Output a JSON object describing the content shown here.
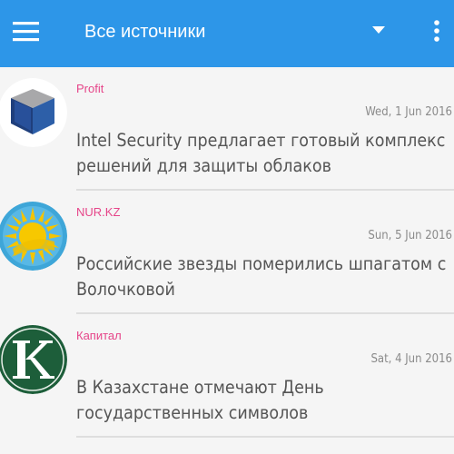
{
  "toolbar": {
    "title": "Все источники",
    "background": "#2d96e8",
    "menu_icon": "hamburger-menu-icon",
    "dropdown_icon": "caret-down-icon",
    "overflow_icon": "more-vert-icon"
  },
  "news": [
    {
      "source": "Profit",
      "date": "Wed, 1 Jun 2016",
      "headline": "Intel Security предлагает готовый комплекс решений для защиты облаков",
      "thumb_icon": "profit-logo-icon"
    },
    {
      "source": "NUR.KZ",
      "date": "Sun, 5 Jun 2016",
      "headline": "Российские звезды померились шпагатом с Волочковой",
      "thumb_icon": "kazakhstan-sun-logo-icon"
    },
    {
      "source": "Капитал",
      "date": "Sat, 4 Jun 2016",
      "headline": "В Казахстане отмечают День государственных символов",
      "thumb_icon": "kapital-k-logo-icon"
    }
  ],
  "colors": {
    "source_text": "#e64589",
    "date_text": "#8a8a8a",
    "headline_text": "#555555",
    "background": "#f5f5f5"
  }
}
